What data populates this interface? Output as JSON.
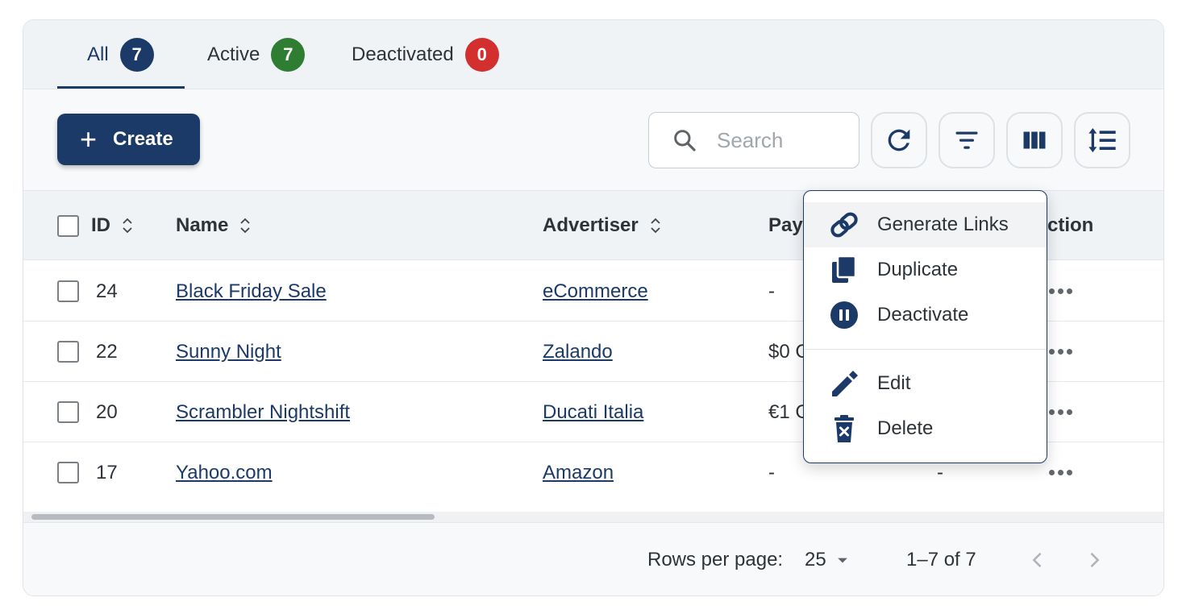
{
  "tabs": [
    {
      "label": "All",
      "count": "7",
      "badge_color": "#1c3a68",
      "active": true
    },
    {
      "label": "Active",
      "count": "7",
      "badge_color": "#2e7d32",
      "active": false
    },
    {
      "label": "Deactivated",
      "count": "0",
      "badge_color": "#d32f2f",
      "active": false
    }
  ],
  "toolbar": {
    "create_label": "Create",
    "search_placeholder": "Search",
    "buttons": [
      "refresh-icon",
      "filter-icon",
      "columns-icon",
      "density-icon"
    ]
  },
  "table": {
    "headers": {
      "id": "ID",
      "name": "Name",
      "advertiser": "Advertiser",
      "payout": "Pay",
      "action": "ction"
    },
    "rows": [
      {
        "id": "24",
        "name": "Black Friday Sale",
        "advertiser": "eCommerce",
        "payout": "-",
        "extra": ""
      },
      {
        "id": "22",
        "name": "Sunny Night",
        "advertiser": "Zalando",
        "payout": "$0 C",
        "extra": ""
      },
      {
        "id": "20",
        "name": "Scrambler Nightshift",
        "advertiser": "Ducati Italia",
        "payout": "€1 C",
        "extra": ""
      },
      {
        "id": "17",
        "name": "Yahoo.com",
        "advertiser": "Amazon",
        "payout": "-",
        "extra": "-"
      }
    ],
    "scroll_position": 0.0
  },
  "footer": {
    "rows_per_page_label": "Rows per page:",
    "rows_per_page_value": "25",
    "range": "1–7 of 7"
  },
  "context_menu": {
    "items": [
      {
        "label": "Generate Links",
        "icon": "link-icon",
        "highlighted": true
      },
      {
        "label": "Duplicate",
        "icon": "duplicate-icon",
        "highlighted": false
      },
      {
        "label": "Deactivate",
        "icon": "pause-circle-icon",
        "highlighted": false
      },
      {
        "label": "Edit",
        "icon": "pencil-icon",
        "highlighted": false
      },
      {
        "label": "Delete",
        "icon": "trash-icon",
        "highlighted": false
      }
    ]
  },
  "colors": {
    "primary": "#1c3a68",
    "success": "#2e7d32",
    "danger": "#d32f2f"
  }
}
